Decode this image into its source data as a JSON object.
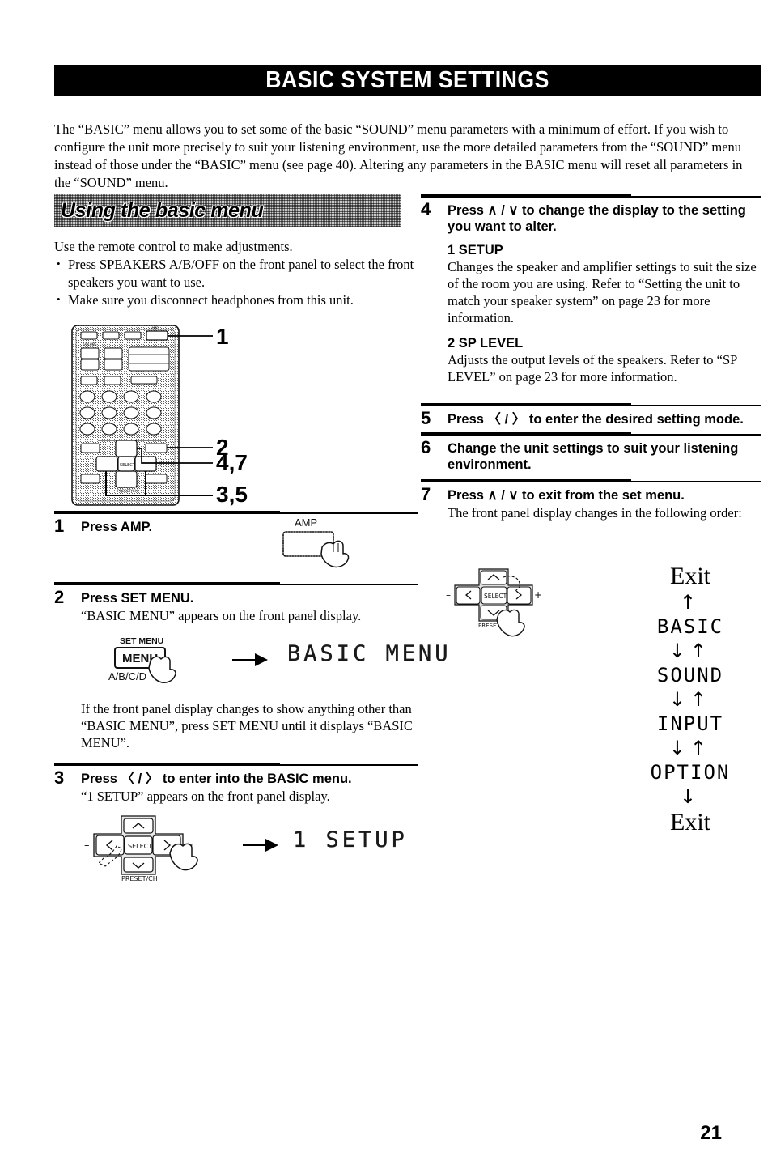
{
  "page": {
    "title": "BASIC SYSTEM SETTINGS",
    "number": "21"
  },
  "intro": "The “BASIC” menu allows you to set some of the basic “SOUND” menu parameters with a minimum of effort. If you wish to configure the unit more precisely to suit your listening environment, use the more detailed parameters from the “SOUND” menu instead of those under the “BASIC” menu (see page 40). Altering any parameters in the BASIC menu will reset all parameters in the “SOUND” menu.",
  "section": {
    "band_label": "Using the basic menu",
    "lead": "Use the remote control to make adjustments.",
    "bullets": [
      "Press SPEAKERS A/B/OFF on the front panel to select the front speakers you want to use.",
      "Make sure you disconnect headphones from this unit."
    ]
  },
  "remote_callouts": {
    "one": "1",
    "two": "2",
    "four_seven": "4,7",
    "three_five": "3,5"
  },
  "remote_labels": {
    "amp": "AMP",
    "select": "SELECT",
    "preset_ch": "PRESET/CH",
    "minus": "–",
    "plus": "+",
    "set_menu": "SET MENU",
    "menu": "MENU",
    "abcd": "A/B/C/D"
  },
  "steps": [
    {
      "num": "1",
      "head": "Press AMP.",
      "body": ""
    },
    {
      "num": "2",
      "head": "Press SET MENU.",
      "body": "“BASIC MENU” appears on the front panel display.",
      "note": "If the front panel display changes to show anything other than “BASIC MENU”, press SET MENU until it displays “BASIC MENU”.",
      "display": "BASIC MENU"
    },
    {
      "num": "3",
      "head": "Press 〈 / 〉 to enter into the BASIC menu.",
      "body": "“1 SETUP” appears on the front panel display.",
      "display": "1 SETUP"
    },
    {
      "num": "4",
      "head": "Press ∧ / ∨ to change the display to the setting you want to alter.",
      "sub": [
        {
          "title": "1 SETUP",
          "text": "Changes the speaker and amplifier settings to suit the size of the room you are using. Refer to “Setting the unit to match your speaker system” on page 23 for more information."
        },
        {
          "title": "2 SP LEVEL",
          "text": "Adjusts the output levels of the speakers. Refer to “SP LEVEL” on page 23 for more information."
        }
      ]
    },
    {
      "num": "5",
      "head": "Press 〈 / 〉 to enter the desired setting mode.",
      "body": ""
    },
    {
      "num": "6",
      "head": "Change the unit settings to suit your listening environment.",
      "body": ""
    },
    {
      "num": "7",
      "head": "Press ∧ / ∨ to exit from the set menu.",
      "body": "The front panel display changes in the following order:"
    }
  ],
  "flow": {
    "exit_top": "Exit",
    "exit_bottom": "Exit",
    "arrow_up": "↑",
    "arrow_down_up": "↓↑",
    "arrow_down": "↓",
    "items": [
      "BASIC",
      "SOUND",
      "INPUT",
      "OPTION"
    ]
  }
}
